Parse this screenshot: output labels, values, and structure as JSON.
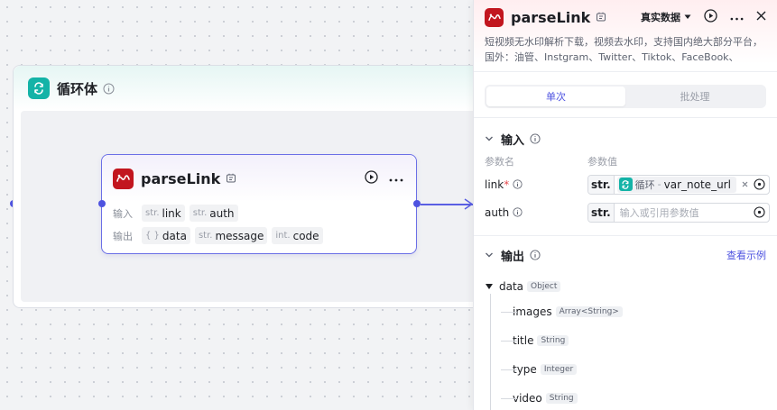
{
  "canvas": {
    "loop": {
      "title": "循环体",
      "icon": "loop-icon"
    },
    "node": {
      "title": "parseLink",
      "input_label": "输入",
      "output_label": "输出",
      "inputs": [
        {
          "type": "str.",
          "name": "link"
        },
        {
          "type": "str.",
          "name": "auth"
        }
      ],
      "outputs": [
        {
          "type": "{ }",
          "name": "data"
        },
        {
          "type": "str.",
          "name": "message"
        },
        {
          "type": "int.",
          "name": "code"
        }
      ]
    }
  },
  "panel": {
    "title": "parseLink",
    "dataset_label": "真实数据",
    "description": "短视频无水印解析下载，视频去水印，支持国内绝大部分平台，国外：油管、Instgram、Twitter、Tiktok、FaceBook、Vimeo、…",
    "tabs": [
      "单次",
      "批处理"
    ],
    "input_section": {
      "title": "输入",
      "col_name": "参数名",
      "col_value": "参数值",
      "params": [
        {
          "name": "link",
          "required_mark": "*",
          "type": "str.",
          "ref_source": "循环",
          "ref_sep": "-",
          "ref_var": "var_note_url"
        },
        {
          "name": "auth",
          "type": "str.",
          "placeholder": "输入或引用参数值"
        }
      ]
    },
    "output_section": {
      "title": "输出",
      "view_example": "查看示例",
      "root": {
        "name": "data",
        "type": "Object"
      },
      "children": [
        {
          "name": "images",
          "type": "Array<String>"
        },
        {
          "name": "title",
          "type": "String"
        },
        {
          "name": "type",
          "type": "Integer"
        },
        {
          "name": "video",
          "type": "String"
        }
      ]
    }
  },
  "colors": {
    "accent": "#4e53e0",
    "loop_teal": "#14b3a7",
    "plugin_red": "#c2161f"
  }
}
